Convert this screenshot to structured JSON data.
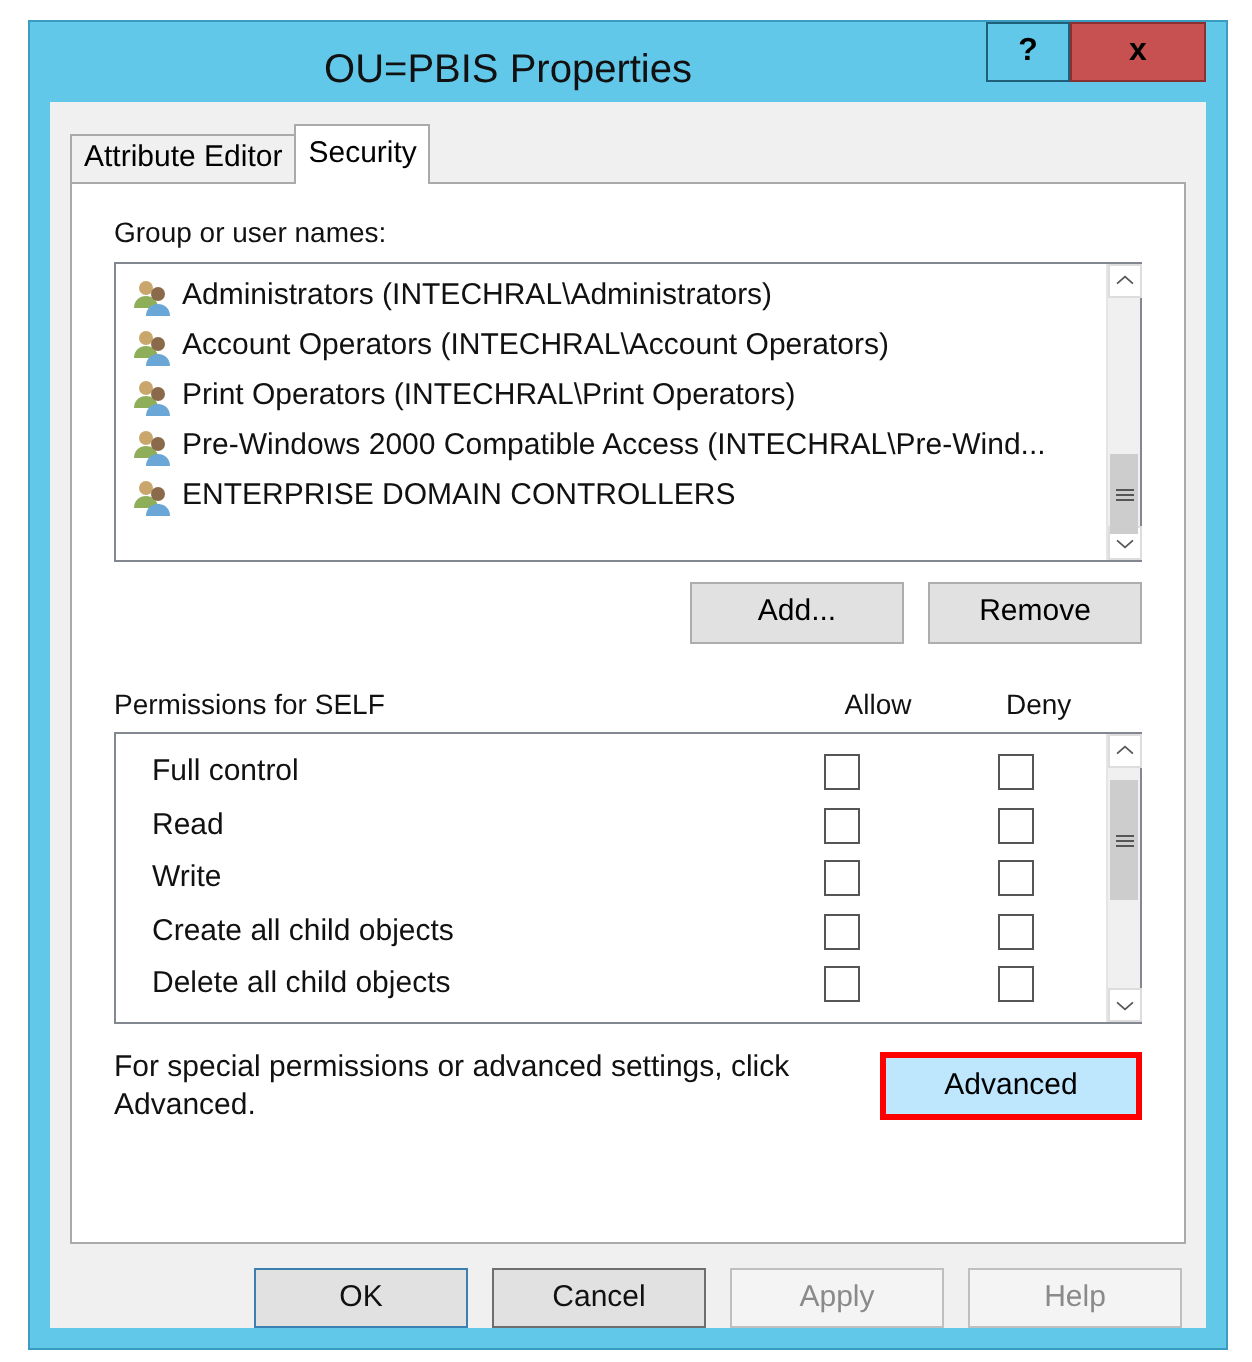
{
  "window": {
    "title": "OU=PBIS Properties",
    "help_button": "?",
    "close_button": "x"
  },
  "tabs": [
    {
      "label": "Attribute Editor",
      "selected": false
    },
    {
      "label": "Security",
      "selected": true
    }
  ],
  "groups": {
    "label": "Group or user names:",
    "items": [
      "Administrators (INTECHRAL\\Administrators)",
      "Account Operators (INTECHRAL\\Account Operators)",
      "Print Operators (INTECHRAL\\Print Operators)",
      "Pre-Windows 2000 Compatible Access (INTECHRAL\\Pre-Wind...",
      "ENTERPRISE DOMAIN CONTROLLERS"
    ],
    "buttons": [
      "Add...",
      "Remove"
    ]
  },
  "permissions": {
    "label": "Permissions for SELF",
    "columns": [
      "Allow",
      "Deny"
    ],
    "rows": [
      {
        "name": "Full control",
        "allow": false,
        "deny": false
      },
      {
        "name": "Read",
        "allow": false,
        "deny": false
      },
      {
        "name": "Write",
        "allow": false,
        "deny": false
      },
      {
        "name": "Create all child objects",
        "allow": false,
        "deny": false
      },
      {
        "name": "Delete all child objects",
        "allow": false,
        "deny": false
      }
    ]
  },
  "advanced": {
    "text": "For special permissions or advanced settings, click Advanced.",
    "button": "Advanced",
    "highlighted": true
  },
  "footer_buttons": [
    {
      "label": "OK",
      "disabled": false,
      "default": true
    },
    {
      "label": "Cancel",
      "disabled": false,
      "default": false
    },
    {
      "label": "Apply",
      "disabled": true,
      "default": false
    },
    {
      "label": "Help",
      "disabled": true,
      "default": false
    }
  ]
}
